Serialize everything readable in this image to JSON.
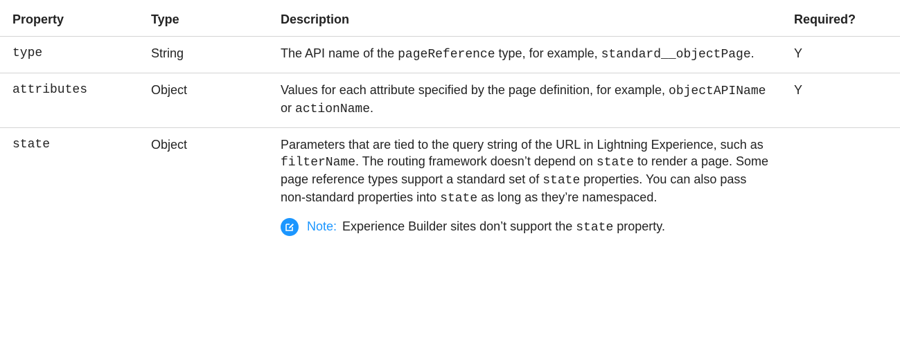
{
  "headers": {
    "property": "Property",
    "type": "Type",
    "description": "Description",
    "required": "Required?"
  },
  "rows": [
    {
      "property": "type",
      "type": "String",
      "desc": {
        "t1": "The API name of the ",
        "c1": "pageReference",
        "t2": " type, for example, ",
        "c2": "standard__objectPage",
        "t3": "."
      },
      "required": "Y"
    },
    {
      "property": "attributes",
      "type": "Object",
      "desc": {
        "t1": "Values for each attribute specified by the page definition, for example, ",
        "c1": "objectAPIName",
        "t2": " or ",
        "c2": "actionName",
        "t3": "."
      },
      "required": "Y"
    },
    {
      "property": "state",
      "type": "Object",
      "desc": {
        "t1": "Parameters that are tied to the query string of the URL in Lightning Experience, such as ",
        "c1": "filterName",
        "t2": ". The routing framework doesn’t depend on ",
        "c2": "state",
        "t3": " to render a page. Some page reference types support a standard set of ",
        "c3": "state",
        "t4": " properties. You can also pass non-standard properties into ",
        "c4": "state",
        "t5": " as long as they’re namespaced."
      },
      "note": {
        "label": "Note:",
        "t1": "Experience Builder sites don’t support the ",
        "c1": "state",
        "t2": " property."
      },
      "required": ""
    }
  ],
  "colors": {
    "accent": "#1b96ff",
    "divider": "#d4d4d4"
  },
  "icons": {
    "note": "edit-note-icon"
  }
}
